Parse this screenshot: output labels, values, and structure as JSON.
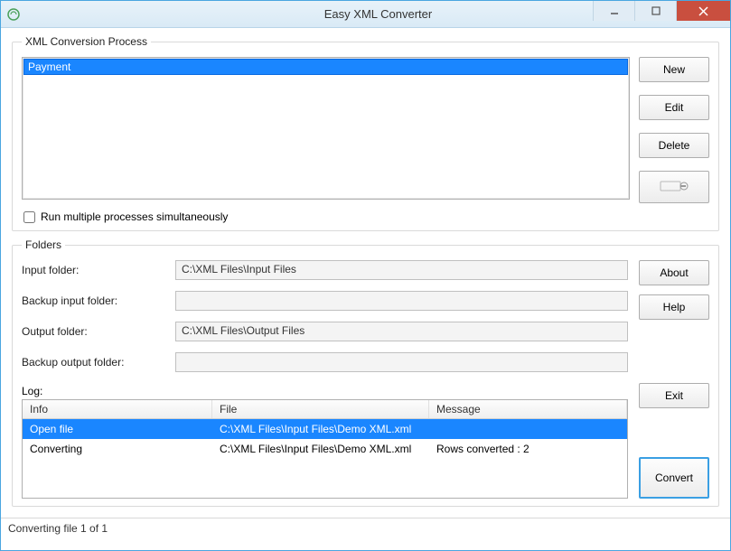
{
  "window": {
    "title": "Easy XML Converter"
  },
  "process": {
    "legend": "XML Conversion Process",
    "items": [
      "Payment"
    ],
    "run_multiple_label": "Run multiple processes simultaneously",
    "buttons": {
      "new": "New",
      "edit": "Edit",
      "delete": "Delete"
    }
  },
  "folders": {
    "legend": "Folders",
    "input_label": "Input folder:",
    "input_value": "C:\\XML Files\\Input Files",
    "backup_input_label": "Backup input folder:",
    "backup_input_value": "",
    "output_label": "Output folder:",
    "output_value": "C:\\XML Files\\Output Files",
    "backup_output_label": "Backup output folder:",
    "backup_output_value": "",
    "log_label": "Log:",
    "log_headers": {
      "info": "Info",
      "file": "File",
      "message": "Message"
    },
    "log_rows": [
      {
        "info": "Open file",
        "file": "C:\\XML Files\\Input Files\\Demo XML.xml",
        "message": ""
      },
      {
        "info": "Converting",
        "file": "C:\\XML Files\\Input Files\\Demo XML.xml",
        "message": "Rows converted : 2"
      }
    ]
  },
  "buttons": {
    "about": "About",
    "help": "Help",
    "exit": "Exit",
    "convert": "Convert"
  },
  "status": "Converting file 1 of 1"
}
